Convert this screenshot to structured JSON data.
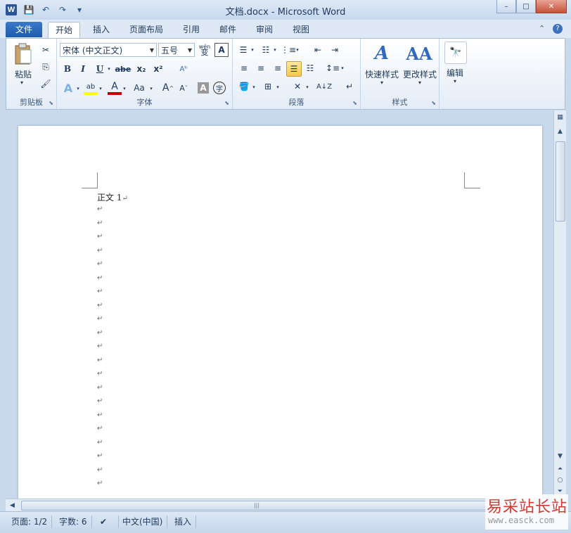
{
  "window": {
    "title": "文档.docx - Microsoft Word",
    "minimize": "–",
    "maximize": "□",
    "close": "✕",
    "logo": "W"
  },
  "qat": {
    "save": "💾",
    "undo": "↶",
    "redo": "↷",
    "more": "▾"
  },
  "tabs": {
    "file": "文件",
    "items": [
      "开始",
      "插入",
      "页面布局",
      "引用",
      "邮件",
      "审阅",
      "视图"
    ],
    "active": "开始"
  },
  "ribbon": {
    "clipboard": {
      "label": "剪贴板",
      "paste": "粘贴"
    },
    "font": {
      "label": "字体",
      "font_name": "宋体 (中文正文)",
      "font_size": "五号",
      "bold": "B",
      "italic": "I",
      "underline": "U",
      "strike": "abe",
      "subscript": "x₂",
      "superscript": "x²",
      "grow": "A",
      "shrink": "A",
      "case": "Aa",
      "font_color_letter": "A",
      "char_shading": "A",
      "enclose": "字",
      "phonetic": "wén",
      "phonetic_char": "变"
    },
    "paragraph": {
      "label": "段落"
    },
    "styles": {
      "label": "样式",
      "quick": "快速样式",
      "change": "更改样式"
    },
    "editing": {
      "label": "编辑",
      "button": "编辑"
    }
  },
  "document": {
    "first_line": "正文 1",
    "paragraph_mark": "↵",
    "empty_paragraph_count": 21
  },
  "statusbar": {
    "page": "页面: 1/2",
    "words": "字数: 6",
    "language": "中文(中国)",
    "mode": "插入"
  },
  "watermark": {
    "text": "易采站长站",
    "url": "www.easck.com"
  },
  "colors": {
    "accent": "#2a5699",
    "file_tab": "#1d5bb0",
    "highlight": "#f8c64e"
  }
}
